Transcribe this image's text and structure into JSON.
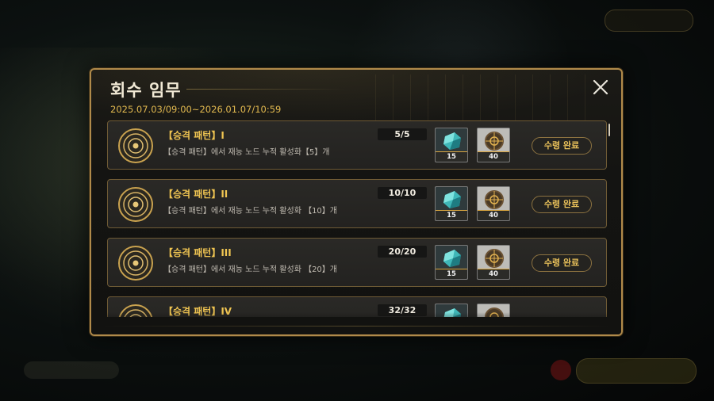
{
  "modal": {
    "title": "회수 임무",
    "period": "2025.07.03/09:00~2026.01.07/10:59",
    "close_icon": "close-icon"
  },
  "missions": [
    {
      "title": "【승격 패턴】I",
      "description": "【승격 패턴】에서 재능 노드 누적 활성화【5】개",
      "progress": "5/5",
      "rewards": [
        {
          "icon": "cyan-crystal-icon",
          "qty": "15"
        },
        {
          "icon": "bronze-compass-icon",
          "qty": "40"
        }
      ],
      "button": "수령 완료"
    },
    {
      "title": "【승격 패턴】II",
      "description": "【승격 패턴】에서 재능 노드 누적 활성화 【10】개",
      "progress": "10/10",
      "rewards": [
        {
          "icon": "cyan-crystal-icon",
          "qty": "15"
        },
        {
          "icon": "bronze-compass-icon",
          "qty": "40"
        }
      ],
      "button": "수령 완료"
    },
    {
      "title": "【승격 패턴】III",
      "description": "【승격 패턴】에서 재능 노드 누적 활성화 【20】개",
      "progress": "20/20",
      "rewards": [
        {
          "icon": "cyan-crystal-icon",
          "qty": "15"
        },
        {
          "icon": "bronze-compass-icon",
          "qty": "40"
        }
      ],
      "button": "수령 완료"
    },
    {
      "title": "【승격 패턴】IV",
      "description": "",
      "progress": "32/32",
      "rewards": [
        {
          "icon": "cyan-crystal-icon",
          "qty": ""
        },
        {
          "icon": "bronze-compass-icon",
          "qty": ""
        }
      ],
      "button": ""
    }
  ],
  "colors": {
    "accent_gold": "#f0c552",
    "frame_gold": "#b08a4a",
    "period_text": "#e0b84f"
  }
}
